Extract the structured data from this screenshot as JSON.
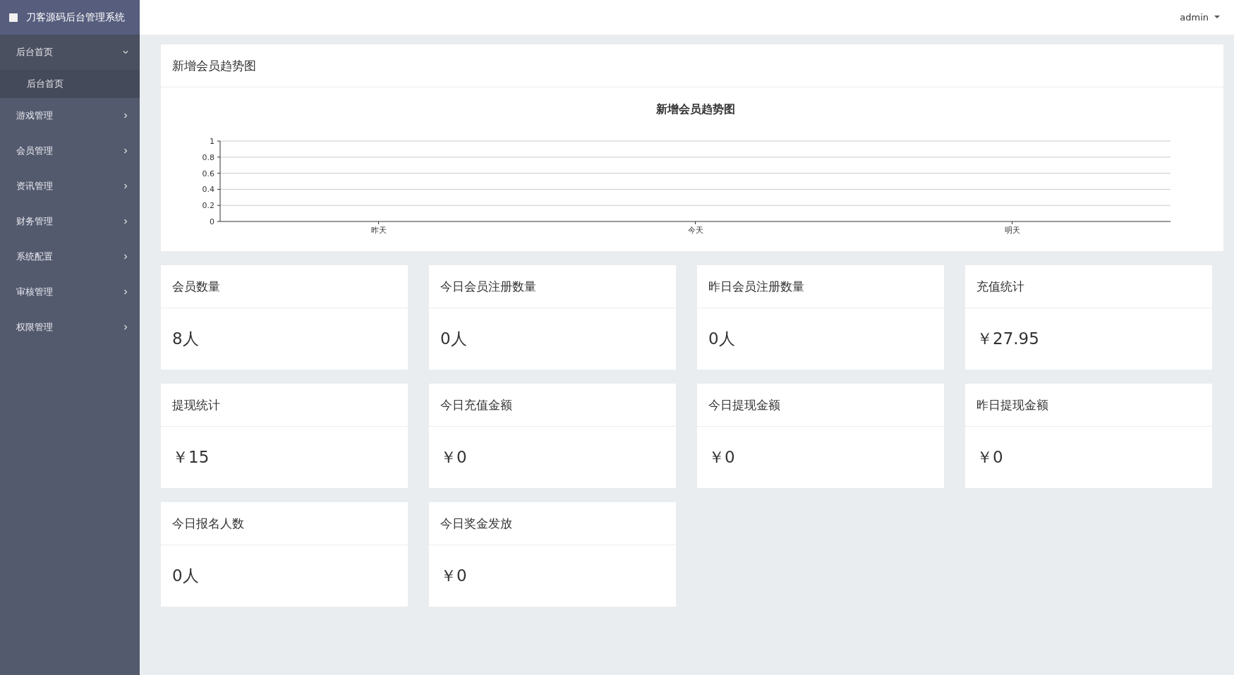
{
  "sidebar": {
    "title": "刀客源码后台管理系统",
    "items": [
      {
        "label": "后台首页",
        "expanded": true,
        "children": [
          {
            "label": "后台首页",
            "selected": true
          }
        ]
      },
      {
        "label": "游戏管理",
        "expanded": false
      },
      {
        "label": "会员管理",
        "expanded": false
      },
      {
        "label": "资讯管理",
        "expanded": false
      },
      {
        "label": "财务管理",
        "expanded": false
      },
      {
        "label": "系统配置",
        "expanded": false
      },
      {
        "label": "审核管理",
        "expanded": false
      },
      {
        "label": "权限管理",
        "expanded": false
      }
    ]
  },
  "header": {
    "user": "admin"
  },
  "chart_panel": {
    "heading": "新增会员趋势图",
    "chart_data": {
      "type": "line",
      "title": "新增会员趋势图",
      "categories": [
        "昨天",
        "今天",
        "明天"
      ],
      "values": [
        null,
        null,
        null
      ],
      "grid": true,
      "ylim": [
        0,
        1
      ],
      "yticks": [
        0,
        0.2,
        0.4,
        0.6,
        0.8,
        1
      ]
    }
  },
  "stats": [
    {
      "title": "会员数量",
      "value": "8人"
    },
    {
      "title": "今日会员注册数量",
      "value": "0人"
    },
    {
      "title": "昨日会员注册数量",
      "value": "0人"
    },
    {
      "title": "充值统计",
      "value": "￥27.95"
    },
    {
      "title": "提现统计",
      "value": "￥15"
    },
    {
      "title": "今日充值金额",
      "value": "￥0"
    },
    {
      "title": "今日提现金额",
      "value": "￥0"
    },
    {
      "title": "昨日提现金额",
      "value": "￥0"
    },
    {
      "title": "今日报名人数",
      "value": "0人"
    },
    {
      "title": "今日奖金发放",
      "value": "￥0"
    }
  ]
}
